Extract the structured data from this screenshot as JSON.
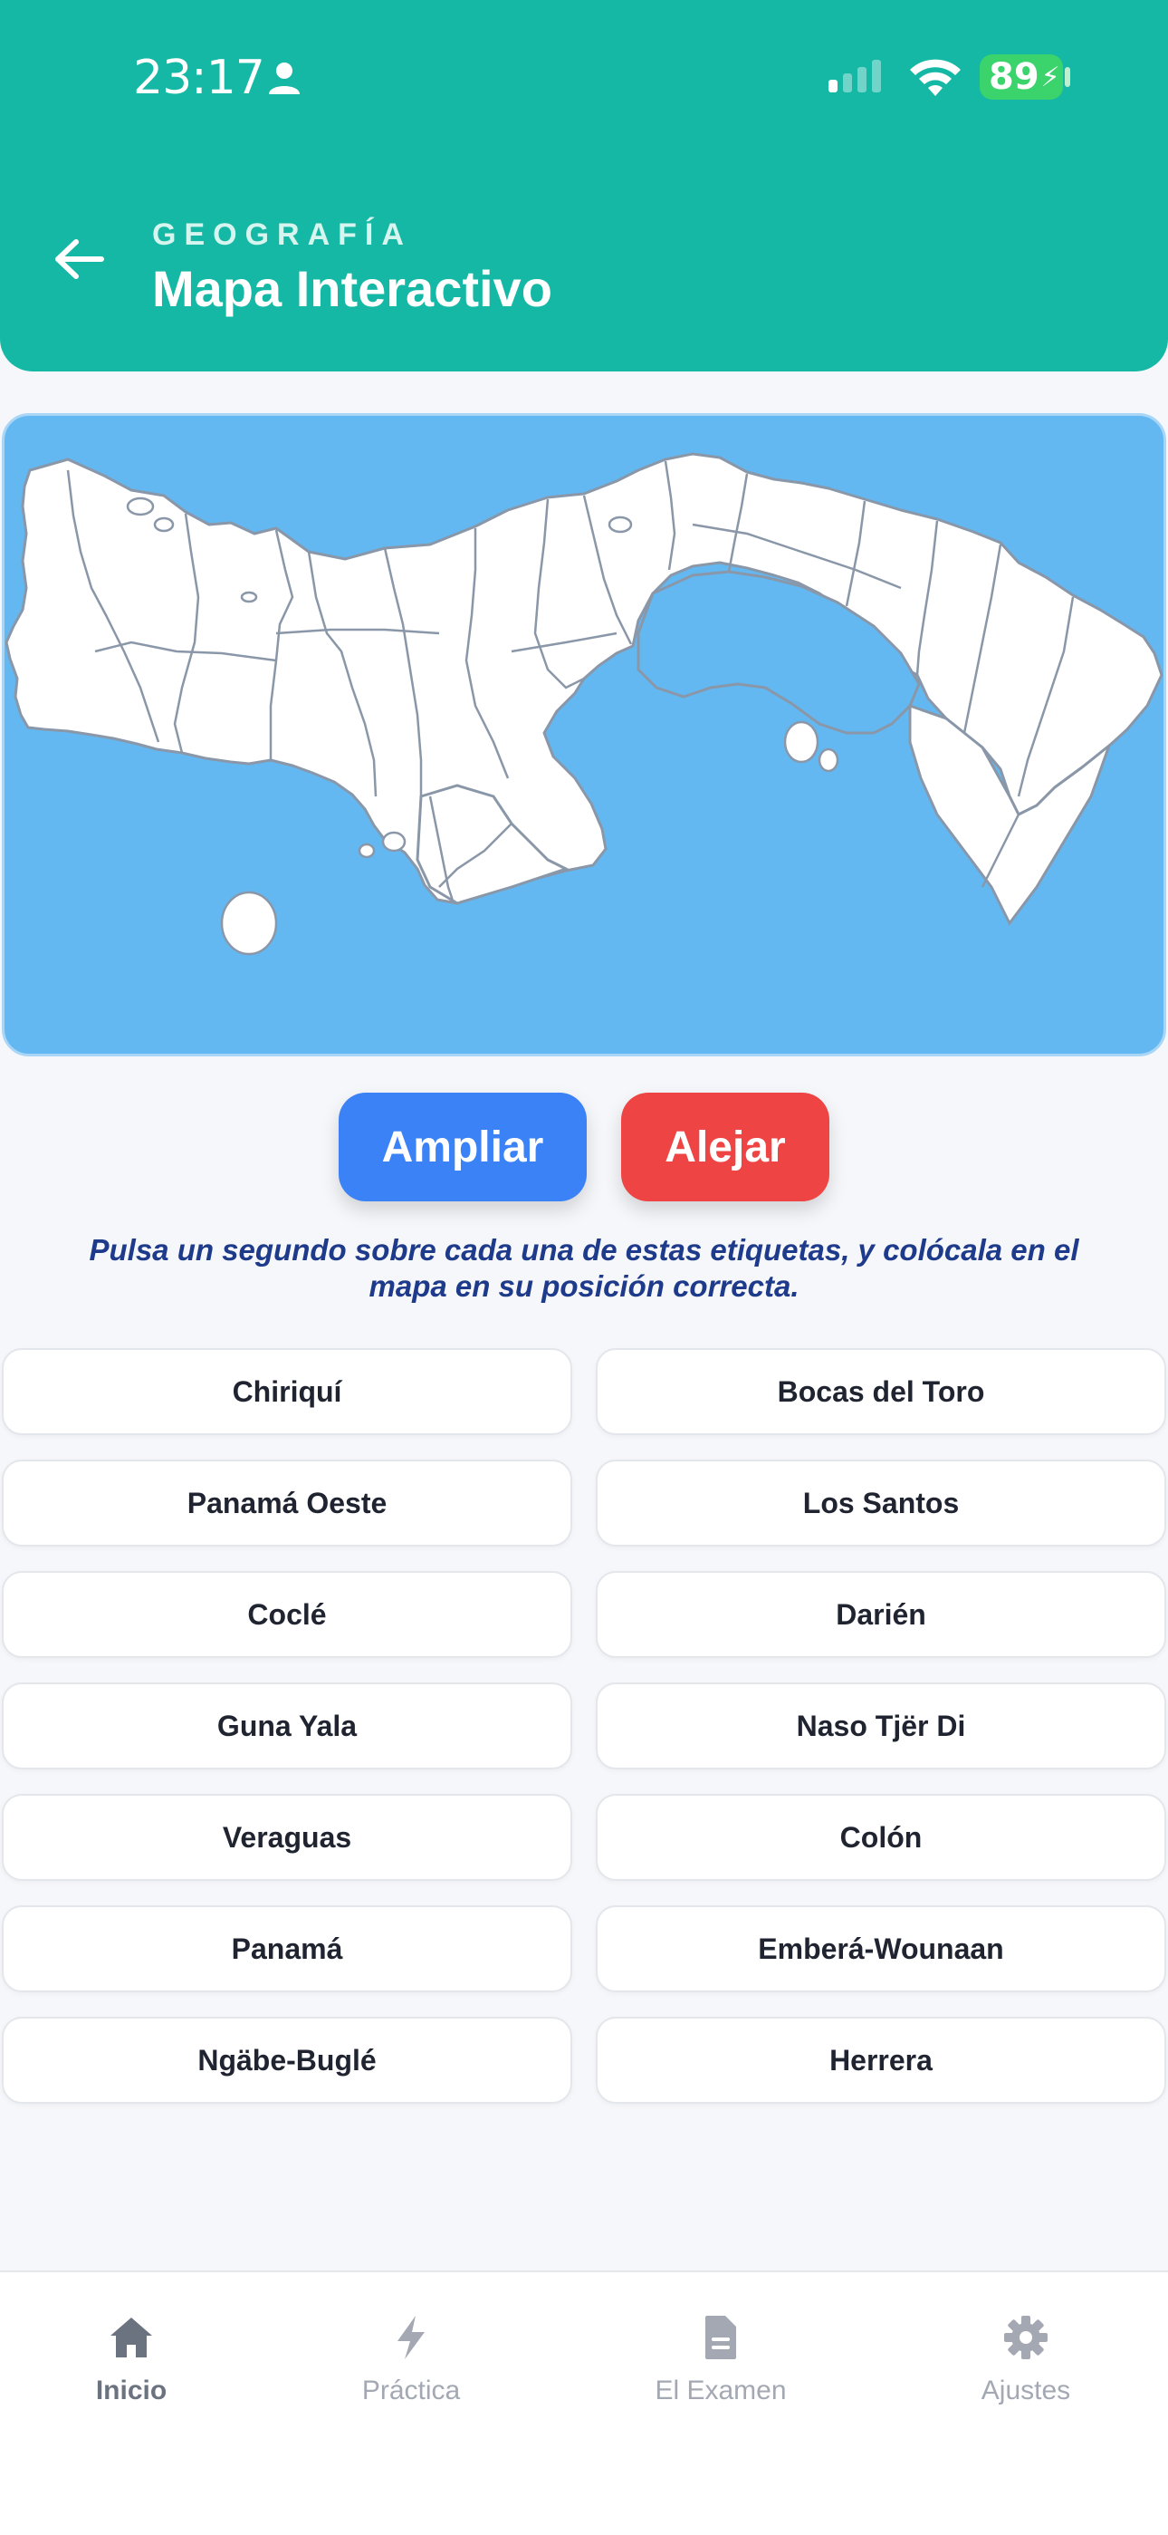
{
  "status_bar": {
    "time": "23:17",
    "battery": "89"
  },
  "header": {
    "subject": "GEOGRAFÍA",
    "title": "Mapa Interactivo",
    "bg_color": "#15b8a4"
  },
  "map": {
    "water_color": "#63b8f2",
    "land_color": "#ffffff",
    "border_color": "#8a97a8"
  },
  "controls": {
    "zoom_in_label": "Ampliar",
    "zoom_out_label": "Alejar",
    "zoom_in_color": "#3b82f6",
    "zoom_out_color": "#ef4444"
  },
  "instruction": "Pulsa un segundo sobre cada una de estas etiquetas, y colócala en el mapa en su posición correcta.",
  "labels": [
    "Chiriquí",
    "Bocas del Toro",
    "Panamá Oeste",
    "Los Santos",
    "Coclé",
    "Darién",
    "Guna Yala",
    "Naso Tjër Di",
    "Veraguas",
    "Colón",
    "Panamá",
    "Emberá-Wounaan",
    "Ngäbe-Buglé",
    "Herrera"
  ],
  "nav": {
    "items": [
      {
        "label": "Inicio",
        "icon": "home-icon",
        "active": true
      },
      {
        "label": "Práctica",
        "icon": "bolt-icon",
        "active": false
      },
      {
        "label": "El Examen",
        "icon": "document-icon",
        "active": false
      },
      {
        "label": "Ajustes",
        "icon": "gear-icon",
        "active": false
      }
    ]
  }
}
